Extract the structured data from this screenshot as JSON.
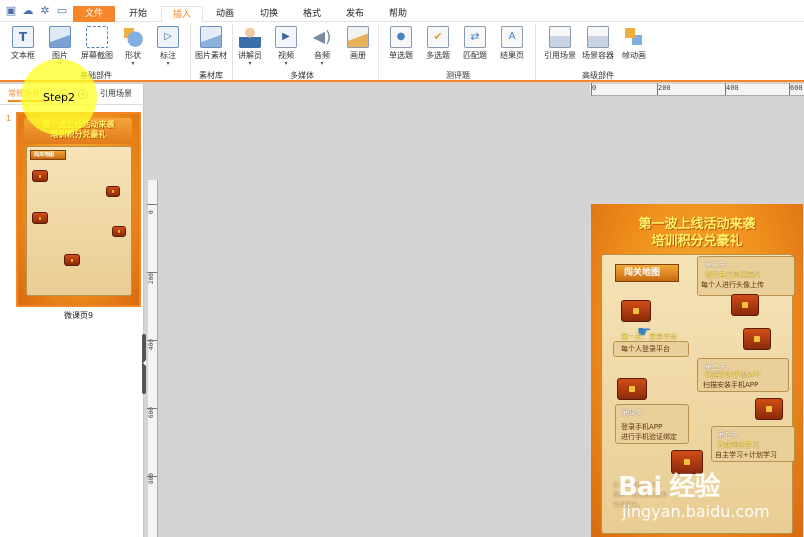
{
  "app": {
    "accent": "#f5862a"
  },
  "quick_access": [
    "save-icon",
    "cloud-icon",
    "settings-icon",
    "preview-icon"
  ],
  "menu": {
    "file": "文件",
    "home": "开始",
    "insert": "插入",
    "animation": "动画",
    "transition": "切换",
    "format": "格式",
    "publish": "发布",
    "help": "帮助"
  },
  "ribbon": {
    "textbox": "文本框",
    "picture": "图片",
    "screenshot": "屏幕截图",
    "shape": "形状",
    "annotate": "标注",
    "basic_group": "基础部件",
    "pic_material": "图片素材",
    "material_group": "素材库",
    "narrator": "讲解员",
    "video": "视频",
    "audio": "音频",
    "album": "画册",
    "media_group": "多媒体",
    "single_choice": "单选题",
    "multi_choice": "多选题",
    "matching": "匹配题",
    "result_page": "结果页",
    "quiz_group": "测评题",
    "ref_scene": "引用场景",
    "scene_container": "场景容器",
    "frame_anim": "帧动画",
    "advanced_group": "高级部件"
  },
  "panel": {
    "tab_common": "常规场景",
    "tab_ref": "引用场景",
    "page_number": "1",
    "page_title": "微课页9"
  },
  "step_label": "Step2",
  "ruler": {
    "h_labels": [
      "0",
      "200",
      "400",
      "600"
    ],
    "v_labels": [
      "0",
      "200",
      "400",
      "600",
      "800"
    ]
  },
  "slide": {
    "title_line1": "第一波上线活动来袭",
    "title_line2": "培训积分兑豪礼",
    "map_tag": "闯关地图",
    "level2_title": "第二关：",
    "level2_line1": "提交自己真实照片",
    "level2_line2": "每个人进行头像上传",
    "level1_title": "第一关：登录平台",
    "level1_line1": "每个人登录平台",
    "level3_title": "第三关：",
    "level3_line1": "扫描安装手机APP",
    "level3_line2": "扫描安装手机APP",
    "level4_title": "第四关：",
    "level4_line1": "登录手机APP",
    "level4_line2": "进行手机验证绑定",
    "level5_title": "第五关：",
    "level5_line1": "完成闯关学习",
    "level5_line2": "自主学习+计划学习",
    "bottom_line1": "在闯关地图中按照",
    "bottom_line2": "顺序，完成闯关获得",
    "bottom_line3": "培训积分。"
  },
  "watermark": {
    "logo": "Bai 经验",
    "url": "jingyan.baidu.com"
  }
}
